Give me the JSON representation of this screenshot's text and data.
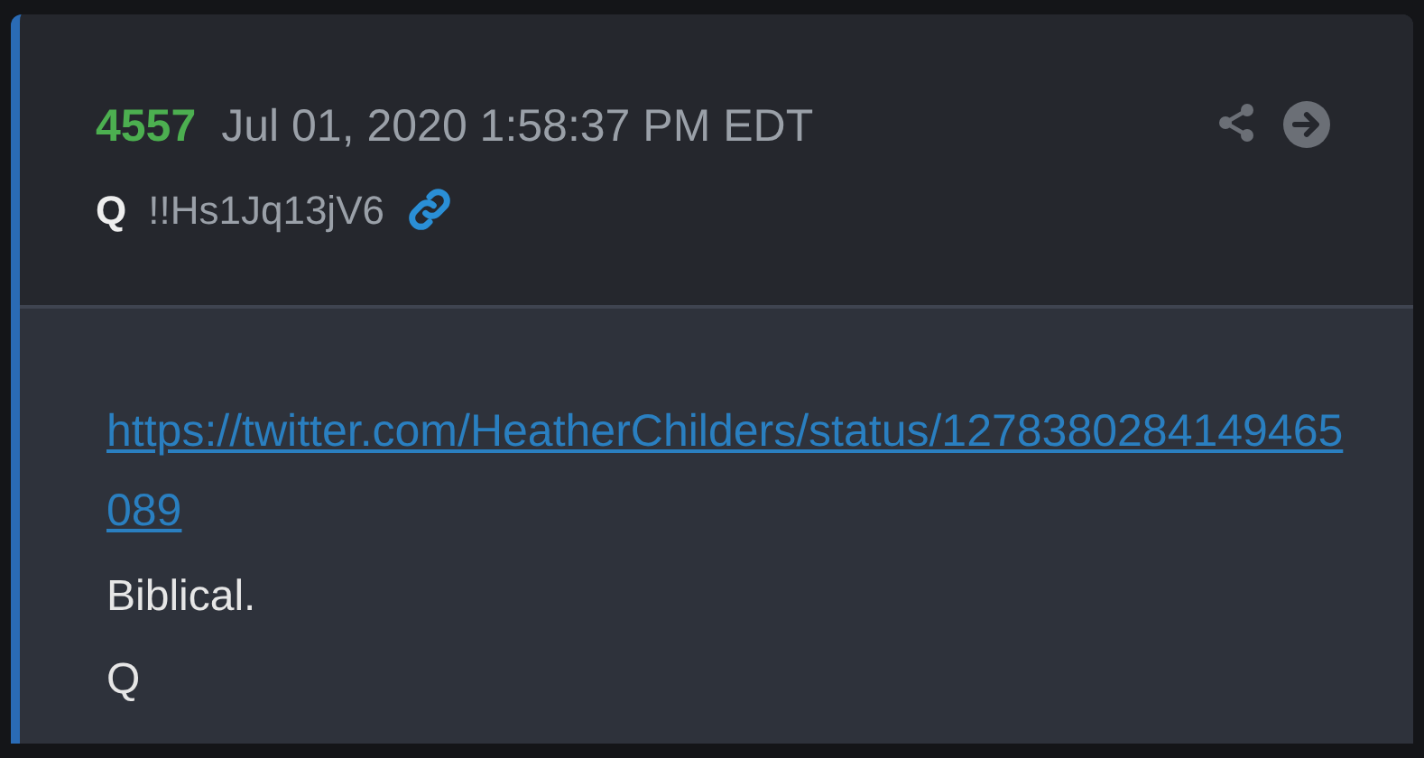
{
  "post": {
    "number": "4557",
    "date": "Jul 01, 2020 1:58:37 PM EDT",
    "author": "Q",
    "tripcode": "!!Hs1Jq13jV6",
    "body": [
      {
        "kind": "link",
        "text": "https://twitter.com/HeatherChilders/status/1278380284149465089"
      },
      {
        "kind": "text",
        "text": "Biblical."
      },
      {
        "kind": "text",
        "text": "Q"
      }
    ]
  }
}
